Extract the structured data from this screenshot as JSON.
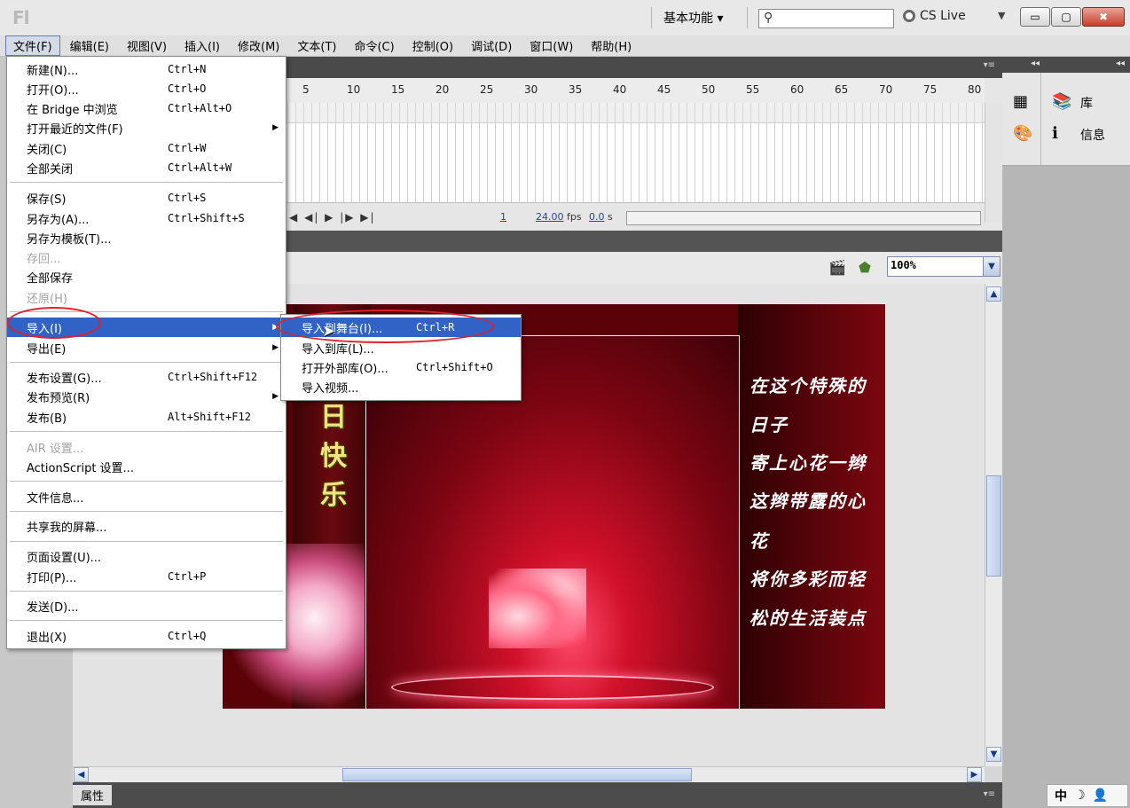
{
  "titlebar": {
    "app_logo": "Fl",
    "workspace_label": "基本功能 ▾",
    "search_placeholder": "",
    "cs_live": "CS Live",
    "minimize": "▭",
    "maximize": "▢",
    "close": "✖"
  },
  "menubar": {
    "items": [
      "文件(F)",
      "编辑(E)",
      "视图(V)",
      "插入(I)",
      "修改(M)",
      "文本(T)",
      "命令(C)",
      "控制(O)",
      "调试(D)",
      "窗口(W)",
      "帮助(H)"
    ]
  },
  "file_menu": {
    "items": [
      {
        "label": "新建(N)...",
        "shortcut": "Ctrl+N"
      },
      {
        "label": "打开(O)...",
        "shortcut": "Ctrl+O"
      },
      {
        "label": "在 Bridge 中浏览",
        "shortcut": "Ctrl+Alt+O"
      },
      {
        "label": "打开最近的文件(F)",
        "shortcut": ""
      },
      {
        "label": "关闭(C)",
        "shortcut": "Ctrl+W"
      },
      {
        "label": "全部关闭",
        "shortcut": "Ctrl+Alt+W"
      },
      {
        "label": "保存(S)",
        "shortcut": "Ctrl+S"
      },
      {
        "label": "另存为(A)...",
        "shortcut": "Ctrl+Shift+S"
      },
      {
        "label": "另存为模板(T)...",
        "shortcut": ""
      },
      {
        "label": "存回...",
        "shortcut": ""
      },
      {
        "label": "全部保存",
        "shortcut": ""
      },
      {
        "label": "还原(H)",
        "shortcut": ""
      },
      {
        "label": "导入(I)",
        "shortcut": ""
      },
      {
        "label": "导出(E)",
        "shortcut": ""
      },
      {
        "label": "发布设置(G)...",
        "shortcut": "Ctrl+Shift+F12"
      },
      {
        "label": "发布预览(R)",
        "shortcut": ""
      },
      {
        "label": "发布(B)",
        "shortcut": "Alt+Shift+F12"
      },
      {
        "label": "AIR 设置...",
        "shortcut": ""
      },
      {
        "label": "ActionScript 设置...",
        "shortcut": ""
      },
      {
        "label": "文件信息...",
        "shortcut": ""
      },
      {
        "label": "共享我的屏幕...",
        "shortcut": ""
      },
      {
        "label": "页面设置(U)...",
        "shortcut": ""
      },
      {
        "label": "打印(P)...",
        "shortcut": "Ctrl+P"
      },
      {
        "label": "发送(D)...",
        "shortcut": ""
      },
      {
        "label": "退出(X)",
        "shortcut": "Ctrl+Q"
      }
    ]
  },
  "import_menu": {
    "items": [
      {
        "label": "导入到舞台(I)...",
        "shortcut": "Ctrl+R"
      },
      {
        "label": "导入到库(L)...",
        "shortcut": ""
      },
      {
        "label": "打开外部库(O)...",
        "shortcut": "Ctrl+Shift+O"
      },
      {
        "label": "导入视频...",
        "shortcut": ""
      }
    ]
  },
  "timeline": {
    "ticks": [
      "5",
      "10",
      "15",
      "20",
      "25",
      "30",
      "35",
      "40",
      "45",
      "50",
      "55",
      "60",
      "65",
      "70",
      "75",
      "80"
    ],
    "controls": "|◀ ◀| ▶ |▶ ▶|",
    "current_frame": "1",
    "fps_value": "24.00",
    "fps_unit": "fps",
    "time_value": "0.0",
    "time_unit": "s"
  },
  "editbar": {
    "zoom": "100%"
  },
  "stage": {
    "vertical_title": [
      "日",
      "快",
      "乐"
    ],
    "poem_lines": [
      "在这个特殊的",
      "日子",
      "寄上心花一辫",
      "这辫带露的心",
      "花",
      "将你多彩而轻",
      "松的生活装点"
    ]
  },
  "right_panel": {
    "library_label": "库",
    "info_label": "信息"
  },
  "properties": {
    "tab_label": "属性"
  },
  "ime": {
    "label": "中"
  },
  "colors": {
    "menu_highlight": "#3163c6",
    "annotation_red": "#e0202a",
    "stage_background": "#5b0208"
  }
}
